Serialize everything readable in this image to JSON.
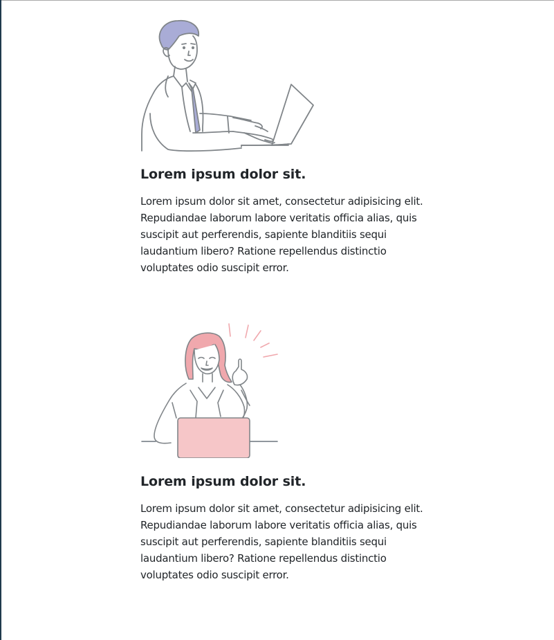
{
  "features": [
    {
      "illustration": "man-typing-laptop-illustration",
      "title": "Lorem ipsum dolor sit.",
      "text_lines": [
        "Lorem ipsum dolor sit amet, consectetur adipisicing elit.",
        "Repudiandae laborum labore veritatis officia alias, quis",
        "suscipit aut perferendis, sapiente blanditiis sequi",
        "laudantium libero? Ratione repellendus distinctio",
        "voluptates odio suscipit error."
      ]
    },
    {
      "illustration": "woman-idea-laptop-illustration",
      "title": "Lorem ipsum dolor sit.",
      "text_lines": [
        "Lorem ipsum dolor sit amet, consectetur adipisicing elit.",
        "Repudiandae laborum labore veritatis officia alias, quis",
        "suscipit aut perferendis, sapiente blanditiis sequi",
        "laudantium libero? Ratione repellendus distinctio",
        "voluptates odio suscipit error."
      ]
    }
  ],
  "colors": {
    "text": "#212529",
    "line_art": "#808589",
    "hair_blue": "#a9acd6",
    "hair_pink": "#f0a8ad",
    "laptop_pink": "#f6c6c8"
  }
}
